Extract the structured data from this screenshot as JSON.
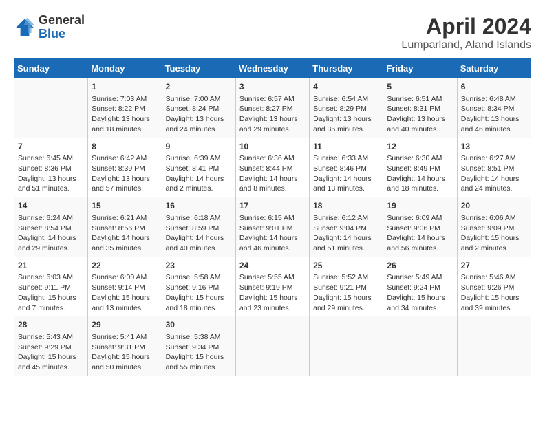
{
  "header": {
    "logo_line1": "General",
    "logo_line2": "Blue",
    "month_year": "April 2024",
    "location": "Lumparland, Aland Islands"
  },
  "days_of_week": [
    "Sunday",
    "Monday",
    "Tuesday",
    "Wednesday",
    "Thursday",
    "Friday",
    "Saturday"
  ],
  "weeks": [
    [
      {
        "day": "",
        "info": ""
      },
      {
        "day": "1",
        "info": "Sunrise: 7:03 AM\nSunset: 8:22 PM\nDaylight: 13 hours\nand 18 minutes."
      },
      {
        "day": "2",
        "info": "Sunrise: 7:00 AM\nSunset: 8:24 PM\nDaylight: 13 hours\nand 24 minutes."
      },
      {
        "day": "3",
        "info": "Sunrise: 6:57 AM\nSunset: 8:27 PM\nDaylight: 13 hours\nand 29 minutes."
      },
      {
        "day": "4",
        "info": "Sunrise: 6:54 AM\nSunset: 8:29 PM\nDaylight: 13 hours\nand 35 minutes."
      },
      {
        "day": "5",
        "info": "Sunrise: 6:51 AM\nSunset: 8:31 PM\nDaylight: 13 hours\nand 40 minutes."
      },
      {
        "day": "6",
        "info": "Sunrise: 6:48 AM\nSunset: 8:34 PM\nDaylight: 13 hours\nand 46 minutes."
      }
    ],
    [
      {
        "day": "7",
        "info": "Sunrise: 6:45 AM\nSunset: 8:36 PM\nDaylight: 13 hours\nand 51 minutes."
      },
      {
        "day": "8",
        "info": "Sunrise: 6:42 AM\nSunset: 8:39 PM\nDaylight: 13 hours\nand 57 minutes."
      },
      {
        "day": "9",
        "info": "Sunrise: 6:39 AM\nSunset: 8:41 PM\nDaylight: 14 hours\nand 2 minutes."
      },
      {
        "day": "10",
        "info": "Sunrise: 6:36 AM\nSunset: 8:44 PM\nDaylight: 14 hours\nand 8 minutes."
      },
      {
        "day": "11",
        "info": "Sunrise: 6:33 AM\nSunset: 8:46 PM\nDaylight: 14 hours\nand 13 minutes."
      },
      {
        "day": "12",
        "info": "Sunrise: 6:30 AM\nSunset: 8:49 PM\nDaylight: 14 hours\nand 18 minutes."
      },
      {
        "day": "13",
        "info": "Sunrise: 6:27 AM\nSunset: 8:51 PM\nDaylight: 14 hours\nand 24 minutes."
      }
    ],
    [
      {
        "day": "14",
        "info": "Sunrise: 6:24 AM\nSunset: 8:54 PM\nDaylight: 14 hours\nand 29 minutes."
      },
      {
        "day": "15",
        "info": "Sunrise: 6:21 AM\nSunset: 8:56 PM\nDaylight: 14 hours\nand 35 minutes."
      },
      {
        "day": "16",
        "info": "Sunrise: 6:18 AM\nSunset: 8:59 PM\nDaylight: 14 hours\nand 40 minutes."
      },
      {
        "day": "17",
        "info": "Sunrise: 6:15 AM\nSunset: 9:01 PM\nDaylight: 14 hours\nand 46 minutes."
      },
      {
        "day": "18",
        "info": "Sunrise: 6:12 AM\nSunset: 9:04 PM\nDaylight: 14 hours\nand 51 minutes."
      },
      {
        "day": "19",
        "info": "Sunrise: 6:09 AM\nSunset: 9:06 PM\nDaylight: 14 hours\nand 56 minutes."
      },
      {
        "day": "20",
        "info": "Sunrise: 6:06 AM\nSunset: 9:09 PM\nDaylight: 15 hours\nand 2 minutes."
      }
    ],
    [
      {
        "day": "21",
        "info": "Sunrise: 6:03 AM\nSunset: 9:11 PM\nDaylight: 15 hours\nand 7 minutes."
      },
      {
        "day": "22",
        "info": "Sunrise: 6:00 AM\nSunset: 9:14 PM\nDaylight: 15 hours\nand 13 minutes."
      },
      {
        "day": "23",
        "info": "Sunrise: 5:58 AM\nSunset: 9:16 PM\nDaylight: 15 hours\nand 18 minutes."
      },
      {
        "day": "24",
        "info": "Sunrise: 5:55 AM\nSunset: 9:19 PM\nDaylight: 15 hours\nand 23 minutes."
      },
      {
        "day": "25",
        "info": "Sunrise: 5:52 AM\nSunset: 9:21 PM\nDaylight: 15 hours\nand 29 minutes."
      },
      {
        "day": "26",
        "info": "Sunrise: 5:49 AM\nSunset: 9:24 PM\nDaylight: 15 hours\nand 34 minutes."
      },
      {
        "day": "27",
        "info": "Sunrise: 5:46 AM\nSunset: 9:26 PM\nDaylight: 15 hours\nand 39 minutes."
      }
    ],
    [
      {
        "day": "28",
        "info": "Sunrise: 5:43 AM\nSunset: 9:29 PM\nDaylight: 15 hours\nand 45 minutes."
      },
      {
        "day": "29",
        "info": "Sunrise: 5:41 AM\nSunset: 9:31 PM\nDaylight: 15 hours\nand 50 minutes."
      },
      {
        "day": "30",
        "info": "Sunrise: 5:38 AM\nSunset: 9:34 PM\nDaylight: 15 hours\nand 55 minutes."
      },
      {
        "day": "",
        "info": ""
      },
      {
        "day": "",
        "info": ""
      },
      {
        "day": "",
        "info": ""
      },
      {
        "day": "",
        "info": ""
      }
    ]
  ]
}
